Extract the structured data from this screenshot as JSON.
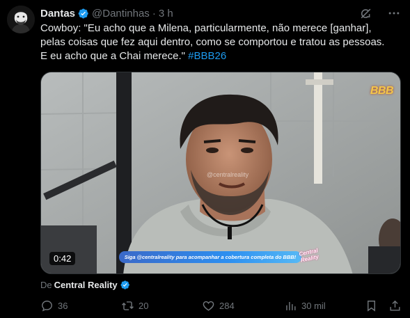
{
  "author": {
    "display_name": "Dantas",
    "handle": "@Dantinhas",
    "separator": "·",
    "time": "3 h",
    "verified": true
  },
  "tweet": {
    "lines": [
      "Cowboy: \"Eu acho que a Milena, particularmente, não merece [ganhar],",
      "pelas coisas que fez aqui dentro, como se comportou e tratou as pessoas.",
      "E eu acho que a Chai merece.\""
    ],
    "hashtag": "#BBB26"
  },
  "media": {
    "duration": "0:42",
    "banner_text": "Siga @centralreality para acompanhar a cobertura completa do BBB!",
    "overlay_logo": "Central Reality",
    "broadcast_logo": "BBB",
    "watermark": "@centralreality"
  },
  "source": {
    "prefix": "De",
    "name": "Central Reality"
  },
  "actions": {
    "replies": "36",
    "reposts": "20",
    "likes": "284",
    "views": "30 mil"
  },
  "colors": {
    "background": "#000000",
    "text": "#e7e9ea",
    "secondary": "#71767b",
    "accent": "#1d9bf0"
  },
  "icons": [
    "avatar",
    "verified-badge-icon",
    "grok-icon",
    "more-icon",
    "reply-icon",
    "repost-icon",
    "like-icon",
    "views-icon",
    "bookmark-icon",
    "share-icon"
  ]
}
